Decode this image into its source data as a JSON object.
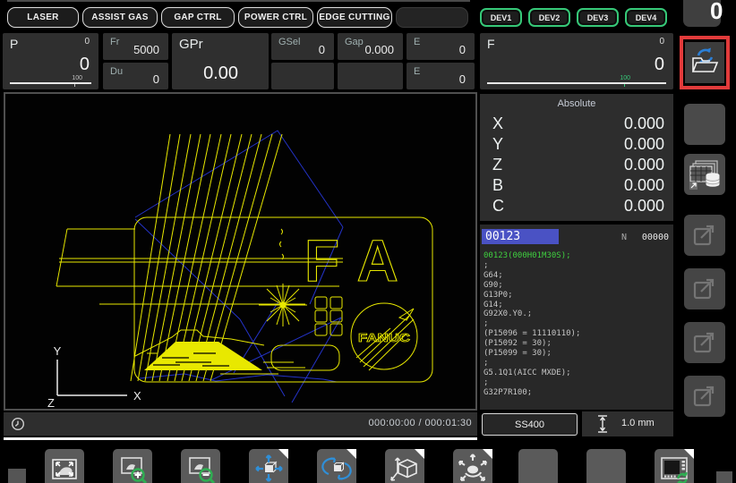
{
  "top_bar": {
    "buttons": [
      "LASER",
      "ASSIST GAS",
      "GAP CTRL",
      "POWER CTRL",
      "EDGE CUTTING"
    ],
    "dev_buttons": [
      "DEV1",
      "DEV2",
      "DEV3",
      "DEV4"
    ]
  },
  "params": {
    "p": {
      "label": "P",
      "top_value": "0",
      "value": "0",
      "scale_label": "100"
    },
    "fr": {
      "label": "Fr",
      "value": "5000"
    },
    "du": {
      "label": "Du",
      "value": "0"
    },
    "gpr": {
      "label": "GPr",
      "value": "0.00"
    },
    "gsel": {
      "label": "GSel",
      "value": "0"
    },
    "gap": {
      "label": "Gap",
      "value": "0.000"
    },
    "e_top": {
      "label": "E",
      "value": "0"
    },
    "e_bottom": {
      "label": "E",
      "value": "0"
    },
    "f": {
      "label": "F",
      "top_value": "0",
      "value": "0",
      "scale_label": "100"
    }
  },
  "position": {
    "title": "Absolute",
    "rows": [
      {
        "axis": "X",
        "value": "0.000"
      },
      {
        "axis": "Y",
        "value": "0.000"
      },
      {
        "axis": "Z",
        "value": "0.000"
      },
      {
        "axis": "B",
        "value": "0.000"
      },
      {
        "axis": "C",
        "value": "0.000"
      }
    ]
  },
  "program": {
    "number": "00123",
    "n_label": "N",
    "sequence": "00000",
    "lines": [
      "00123(000H01M30S);",
      ";",
      "G64;",
      "G90;",
      "G13P0;",
      "G14;",
      "G92X0.Y0.;",
      ";",
      "(P15096 = 11110110);",
      "(P15092 = 30);",
      "(P15099 = 30);",
      ";",
      "G5.1Q1(AICC MXDE);",
      ";",
      "G32P7R100;"
    ]
  },
  "status": {
    "time_elapsed": "000:00:00",
    "time_separator": "/",
    "time_total": "000:01:30",
    "material": "SS400",
    "thickness": "1.0 mm"
  },
  "sidebar": {
    "counter_value": "0"
  },
  "drawing": {
    "fa_text": "FA",
    "logo_text": "FANUC",
    "axis_x": "X",
    "axis_y": "Y",
    "axis_z": "Z"
  },
  "icons": {
    "sidebar": [
      "parts-counter",
      "program-reload-folder",
      "blank",
      "tool-database",
      "external-edit",
      "external-edit",
      "external-edit",
      "external-edit"
    ],
    "toolbar": [
      "fit-view",
      "zoom-in",
      "zoom-out",
      "pan-view",
      "rotate-cycle",
      "iso-view",
      "free-rotate",
      "blank",
      "blank",
      "machine-screen-refresh"
    ],
    "status": [
      "timer-icon",
      "thickness-icon"
    ]
  },
  "colors": {
    "accent_yellow": "#e8e800",
    "path_blue": "#2433c8",
    "dev_green": "#36c878",
    "highlight_red": "#e23b3b",
    "program_highlight": "#4a52c4",
    "code_green": "#3fcf3f",
    "progress_white": "#f8f8f8"
  }
}
